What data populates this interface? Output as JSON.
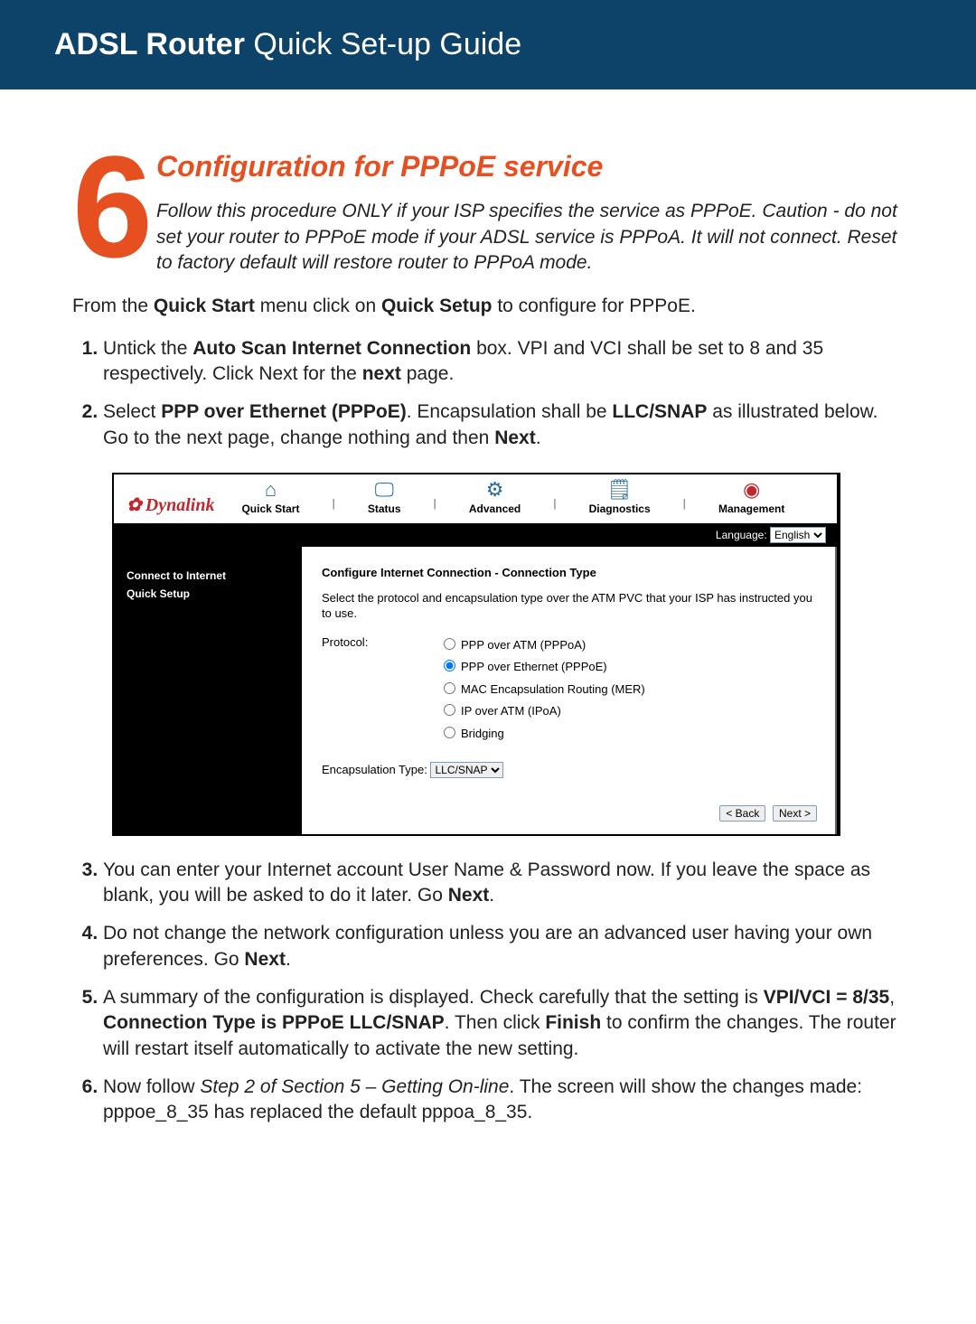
{
  "header": {
    "title_bold": "ADSL Router",
    "title_rest": " Quick Set-up Guide"
  },
  "section_number": "6",
  "heading": "Configuration for PPPoE service",
  "intro": "Follow this procedure ONLY if your ISP specifies the service as PPPoE. Caution - do not set your router to PPPoE mode if your ADSL service is PPPoA. It will not connect. Reset to factory default will restore router to PPPoA mode.",
  "lead_pre": "From the ",
  "lead_b1": "Quick Start",
  "lead_mid": " menu click on ",
  "lead_b2": "Quick Setup",
  "lead_post": " to configure for PPPoE.",
  "steps": {
    "s1_a": "Untick the ",
    "s1_b": "Auto Scan Internet Connection",
    "s1_c": " box. VPI and VCI shall be set to 8 and 35 respectively. Click Next for the ",
    "s1_d": "next",
    "s1_e": " page.",
    "s2_a": "Select ",
    "s2_b": "PPP over Ethernet (PPPoE)",
    "s2_c": ". Encapsulation shall be ",
    "s2_d": "LLC/SNAP",
    "s2_e": " as illustrated below. Go to the next page, change nothing and then ",
    "s2_f": "Next",
    "s2_g": ".",
    "s3_a": "You can enter your Internet account User Name & Password now. If you leave the space as blank, you will be asked to do it later. Go ",
    "s3_b": "Next",
    "s3_c": ".",
    "s4_a": "Do not change the network configuration unless you are an advanced user having your own preferences. Go ",
    "s4_b": "Next",
    "s4_c": ".",
    "s5_a": "A summary of the configuration is displayed. Check carefully that the setting is ",
    "s5_b": "VPI/VCI = 8/35",
    "s5_c": ", ",
    "s5_d": "Connection Type is PPPoE LLC/SNAP",
    "s5_e": ". Then click ",
    "s5_f": "Finish",
    "s5_g": " to confirm the changes. The router will restart itself automatically to activate the new setting.",
    "s6_a": "Now follow ",
    "s6_b": "Step 2 of Section 5 – Getting On-line",
    "s6_c": ". The screen will show the changes made: pppoe_8_35 has replaced the default pppoa_8_35."
  },
  "router": {
    "brand": "Dynalink",
    "tabs": [
      "Quick Start",
      "Status",
      "Advanced",
      "Diagnostics",
      "Management"
    ],
    "language_label": "Language:",
    "language_value": "English",
    "side": [
      "Connect to Internet",
      "Quick Setup"
    ],
    "panel_title": "Configure Internet Connection - Connection Type",
    "panel_desc": "Select the protocol and encapsulation type over the ATM PVC that your ISP has instructed you to use.",
    "protocol_label": "Protocol:",
    "protocols": [
      "PPP over ATM (PPPoA)",
      "PPP over Ethernet (PPPoE)",
      "MAC Encapsulation Routing (MER)",
      "IP over ATM (IPoA)",
      "Bridging"
    ],
    "protocol_selected_index": 1,
    "enc_label": "Encapsulation Type:",
    "enc_value": "LLC/SNAP",
    "back_btn": "< Back",
    "next_btn": "Next >"
  }
}
